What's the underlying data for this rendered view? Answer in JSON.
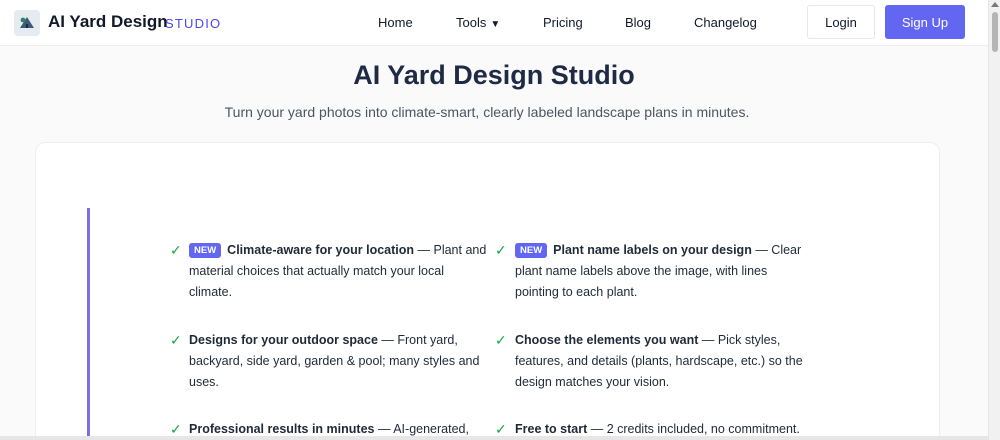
{
  "brand": {
    "name": "AI Yard Design",
    "sub": "STUDIO"
  },
  "nav": {
    "home": "Home",
    "tools": "Tools",
    "tools_caret": "▼",
    "pricing": "Pricing",
    "blog": "Blog",
    "changelog": "Changelog"
  },
  "auth": {
    "login": "Login",
    "signup": "Sign Up"
  },
  "hero": {
    "title": "AI Yard Design Studio",
    "subtitle": "Turn your yard photos into climate-smart, clearly labeled landscape plans in minutes."
  },
  "features": [
    {
      "check": "✓",
      "badge": "NEW",
      "title": "Climate-aware for your location",
      "desc": " — Plant and material choices that actually match your local climate."
    },
    {
      "check": "✓",
      "badge": "NEW",
      "title": "Plant name labels on your design",
      "desc": " — Clear plant name labels above the image, with lines pointing to each plant."
    },
    {
      "check": "✓",
      "badge": "",
      "title": "Designs for your outdoor space",
      "desc": " — Front yard, backyard, side yard, garden & pool; many styles and uses."
    },
    {
      "check": "✓",
      "badge": "",
      "title": "Choose the elements you want",
      "desc": " — Pick styles, features, and details (plants, hardscape, etc.) so the design matches your vision."
    },
    {
      "check": "✓",
      "badge": "",
      "title": "Professional results in minutes",
      "desc": " — AI-generated,"
    },
    {
      "check": "✓",
      "badge": "",
      "title": "Free to start",
      "desc": " — 2 credits included, no commitment."
    }
  ],
  "colors": {
    "accent": "#6366f1",
    "check": "#16a34a"
  }
}
